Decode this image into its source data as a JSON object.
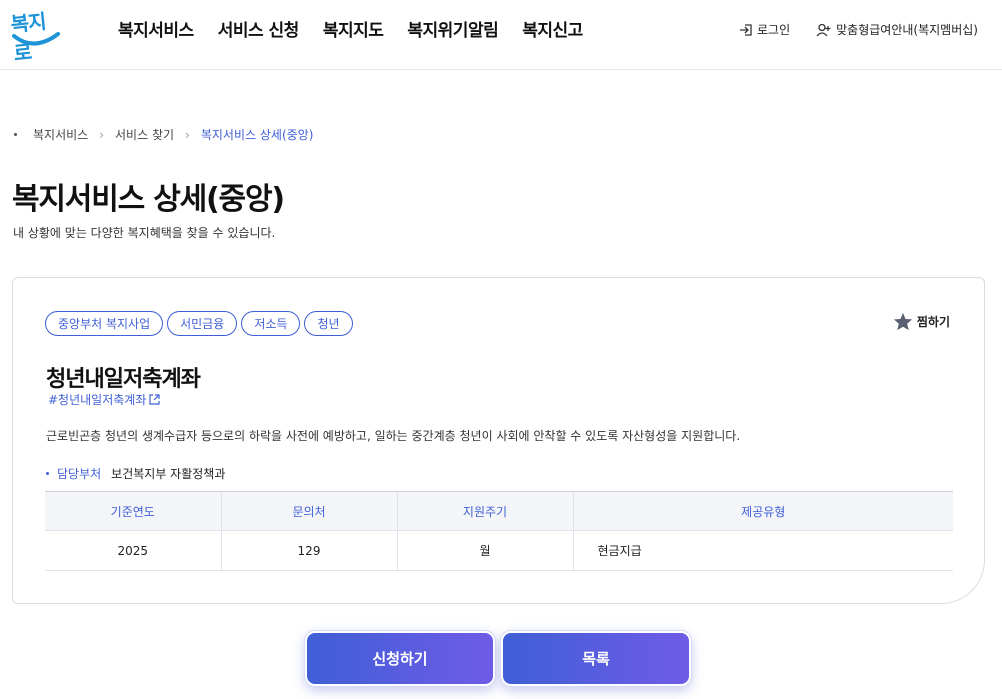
{
  "header": {
    "logo_text": "복지로",
    "nav": [
      "복지서비스",
      "서비스 신청",
      "복지지도",
      "복지위기알림",
      "복지신고"
    ],
    "login_label": "로그인",
    "membership_label": "맞춤형급여안내(복지멤버십)"
  },
  "breadcrumb": [
    "복지서비스",
    "서비스 찾기",
    "복지서비스 상세(중앙)"
  ],
  "page": {
    "title": "복지서비스 상세(중앙)",
    "description": "내 상황에 맞는 다양한 복지혜택을 찾을 수 있습니다."
  },
  "service": {
    "tags": [
      "중앙부처 복지사업",
      "서민금융",
      "저소득",
      "청년"
    ],
    "favorite_label": "찜하기",
    "title": "청년내일저축계좌",
    "hashtag": "#청년내일저축계좌",
    "description": "근로빈곤층 청년의 생계수급자 등으로의 하락을 사전에 예방하고, 일하는 중간계층 청년이 사회에 안착할 수 있도록 자산형성을 지원합니다.",
    "dept_label": "담당부처",
    "dept_value": "보건복지부 자활정책과",
    "table": {
      "headers": [
        "기준연도",
        "문의처",
        "지원주기",
        "제공유형"
      ],
      "row": [
        "2025",
        "129",
        "월",
        "현금지급"
      ]
    }
  },
  "buttons": {
    "apply_label": "신청하기",
    "list_label": "목록"
  },
  "colors": {
    "accent": "#3f5fd6",
    "button_gradient_end": "#6f5be6",
    "logo": "#1f93d8"
  }
}
